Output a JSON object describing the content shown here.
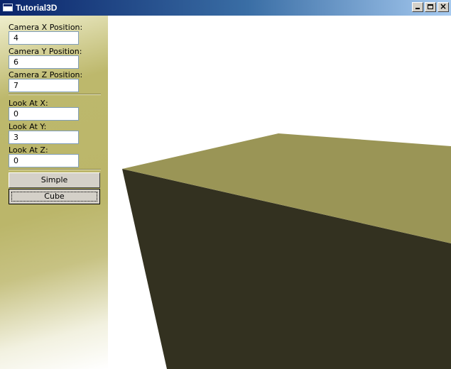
{
  "window": {
    "title": "Tutorial3D",
    "buttons": {
      "minimize": "minimize",
      "maximize": "maximize",
      "close": "close"
    }
  },
  "sidebar": {
    "camera_x": {
      "label": "Camera X Position:",
      "value": "4"
    },
    "camera_y": {
      "label": "Camera Y Position:",
      "value": "6"
    },
    "camera_z": {
      "label": "Camera Z Position:",
      "value": "7"
    },
    "look_x": {
      "label": "Look At X:",
      "value": "0"
    },
    "look_y": {
      "label": "Look At Y:",
      "value": "3"
    },
    "look_z": {
      "label": "Look At Z:",
      "value": "0"
    },
    "simple_button": "Simple",
    "cube_button": "Cube"
  },
  "scene": {
    "top_face_color": "#9a9556",
    "front_face_color": "#333120",
    "background_color": "#ffffff"
  }
}
